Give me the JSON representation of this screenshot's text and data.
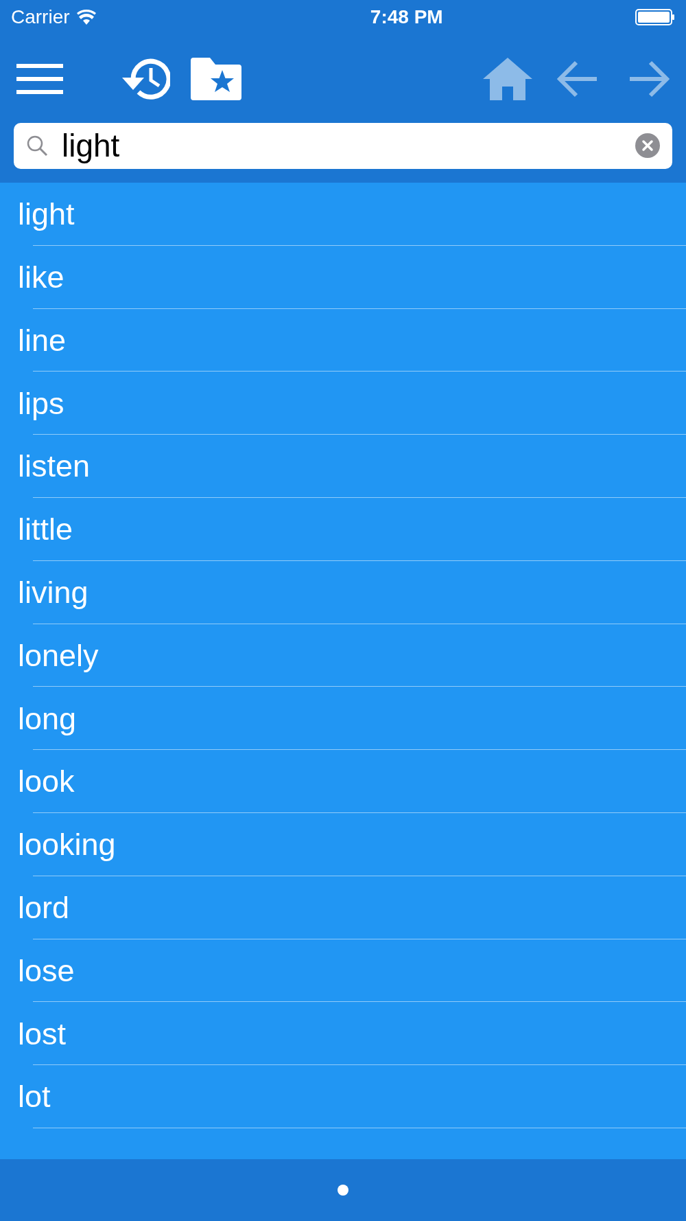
{
  "status_bar": {
    "carrier": "Carrier",
    "time": "7:48 PM"
  },
  "toolbar": [
    {
      "kind": "menu",
      "disabled": false
    },
    {
      "kind": "history",
      "disabled": false
    },
    {
      "kind": "favorites",
      "disabled": false
    },
    {
      "kind": "home",
      "disabled": true
    },
    {
      "kind": "back",
      "disabled": true
    },
    {
      "kind": "forward",
      "disabled": true
    }
  ],
  "search": {
    "value": "light"
  },
  "words": [
    "light",
    "like",
    "line",
    "lips",
    "listen",
    "little",
    "living",
    "lonely",
    "long",
    "look",
    "looking",
    "lord",
    "lose",
    "lost",
    "lot"
  ],
  "page_dots": [
    {
      "selected": true
    }
  ]
}
